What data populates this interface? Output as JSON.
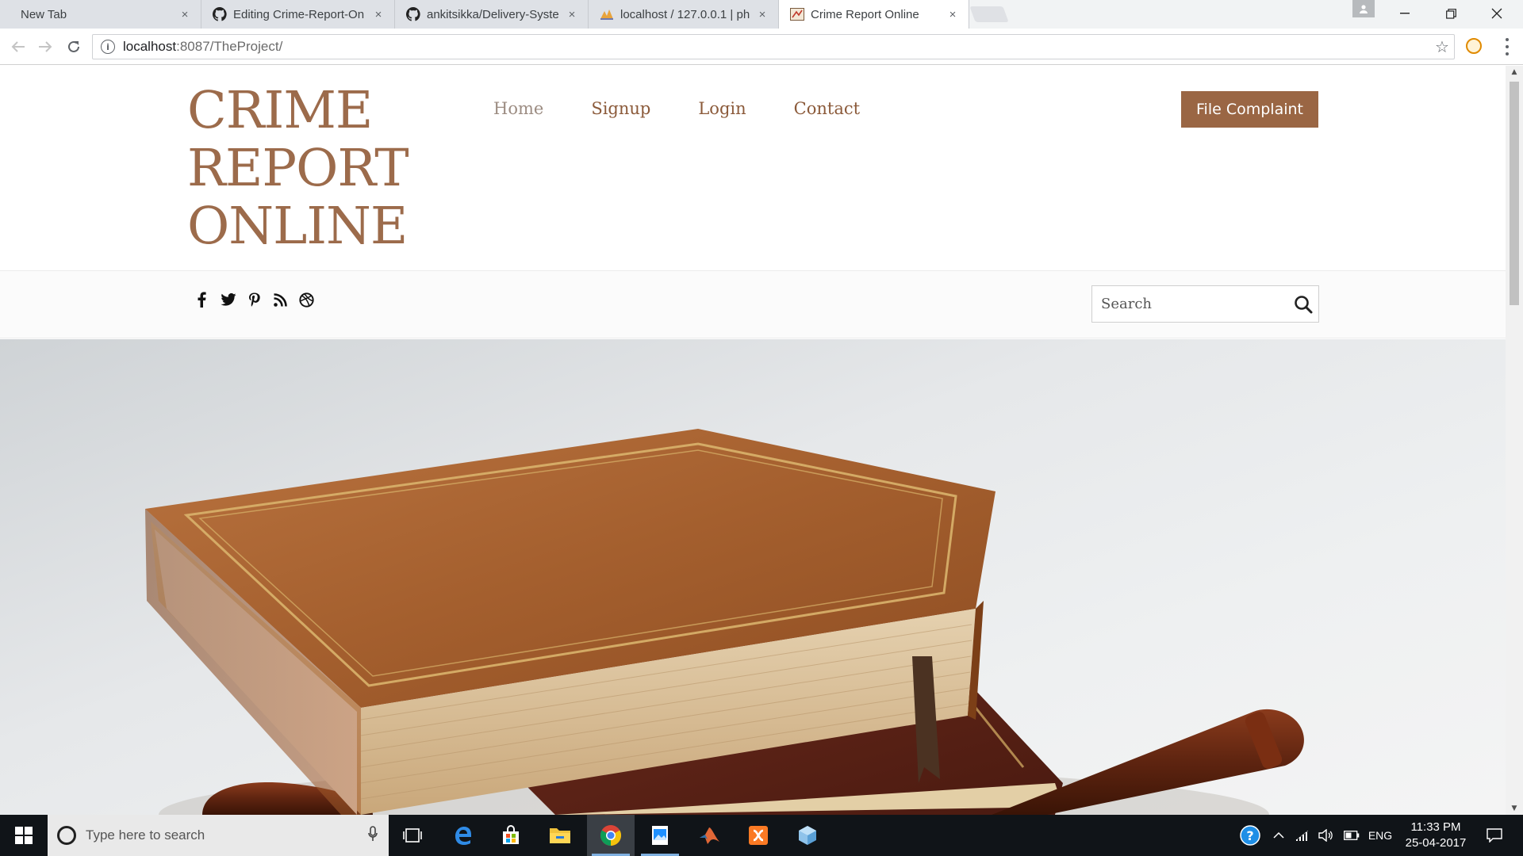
{
  "browser": {
    "tabs": [
      {
        "title": "New Tab"
      },
      {
        "title": "Editing Crime-Report-On"
      },
      {
        "title": "ankitsikka/Delivery-Syste"
      },
      {
        "title": "localhost / 127.0.0.1 | ph"
      },
      {
        "title": "Crime Report Online",
        "active": true
      }
    ],
    "close_glyph": "×",
    "url_host": "localhost",
    "url_path": ":8087/TheProject/"
  },
  "site": {
    "logo_lines": [
      "CRIME",
      "REPORT",
      "ONLINE"
    ],
    "nav": [
      "Home",
      "Signup",
      "Login",
      "Contact"
    ],
    "cta_label": "File Complaint",
    "social_icons": [
      "facebook-icon",
      "twitter-icon",
      "pinterest-icon",
      "rss-icon",
      "dribbble-icon"
    ],
    "search_placeholder": "Search",
    "brand_color": "#9a6644",
    "hero_image": "law books stacked with wooden gavel"
  },
  "taskbar": {
    "search_placeholder": "Type here to search",
    "pinned": [
      "task-view-icon",
      "edge-icon",
      "store-icon",
      "file-explorer-icon",
      "chrome-icon",
      "photos-icon",
      "matlab-icon",
      "xampp-icon",
      "virtualbox-icon"
    ],
    "language": "ENG",
    "time": "11:33 PM",
    "date": "25-04-2017"
  }
}
